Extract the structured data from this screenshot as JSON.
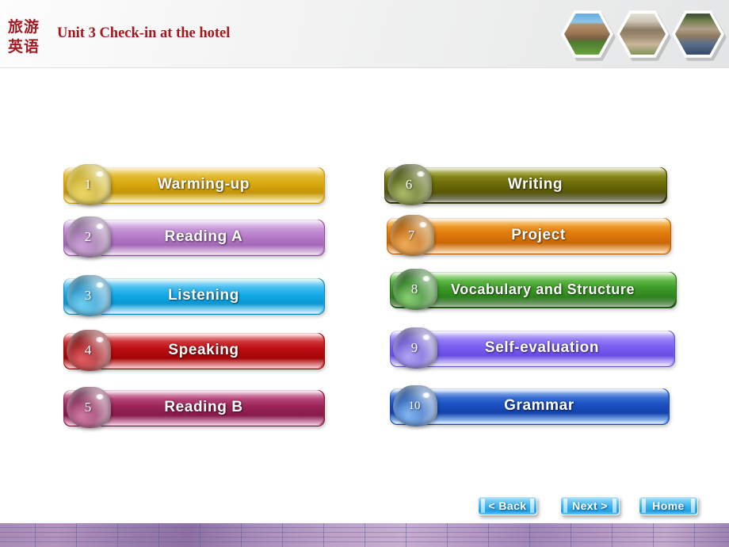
{
  "header": {
    "cn_line1": "旅游",
    "cn_line2": "英语",
    "unit_title": "Unit  3 Check-in  at the hotel",
    "photos": [
      {
        "name": "abbey-ruins-photo"
      },
      {
        "name": "tower-building-photo"
      },
      {
        "name": "castle-street-photo"
      }
    ]
  },
  "menu": {
    "left_column": [
      {
        "number": "1",
        "label": "Warming-up"
      },
      {
        "number": "2",
        "label": "Reading  A"
      },
      {
        "number": "3",
        "label": "Listening"
      },
      {
        "number": "4",
        "label": "Speaking"
      },
      {
        "number": "5",
        "label": "Reading  B"
      }
    ],
    "right_column": [
      {
        "number": "6",
        "label": "Writing"
      },
      {
        "number": "7",
        "label": "Project"
      },
      {
        "number": "8",
        "label": "Vocabulary  and  Structure"
      },
      {
        "number": "9",
        "label": "Self-evaluation"
      },
      {
        "number": "10",
        "label": "Grammar"
      }
    ]
  },
  "nav": {
    "back_label": "< Back",
    "next_label": "Next >",
    "home_label": "Home"
  },
  "colors": {
    "title_red": "#a8151d",
    "btn1_gold": "#d8a80f",
    "btn2_orchid": "#b77cc9",
    "btn3_cyan": "#13a9e8",
    "btn4_crimson": "#bb0d12",
    "btn5_magenta": "#9c2459",
    "btn6_olive": "#6e6e09",
    "btn7_orange": "#e07a0c",
    "btn8_green": "#3f9c2a",
    "btn9_violet": "#7c61f2",
    "btn10_blue": "#1c53c4",
    "nav_blue": "#3fb3ee",
    "footer_purple": "#a88ab5"
  }
}
